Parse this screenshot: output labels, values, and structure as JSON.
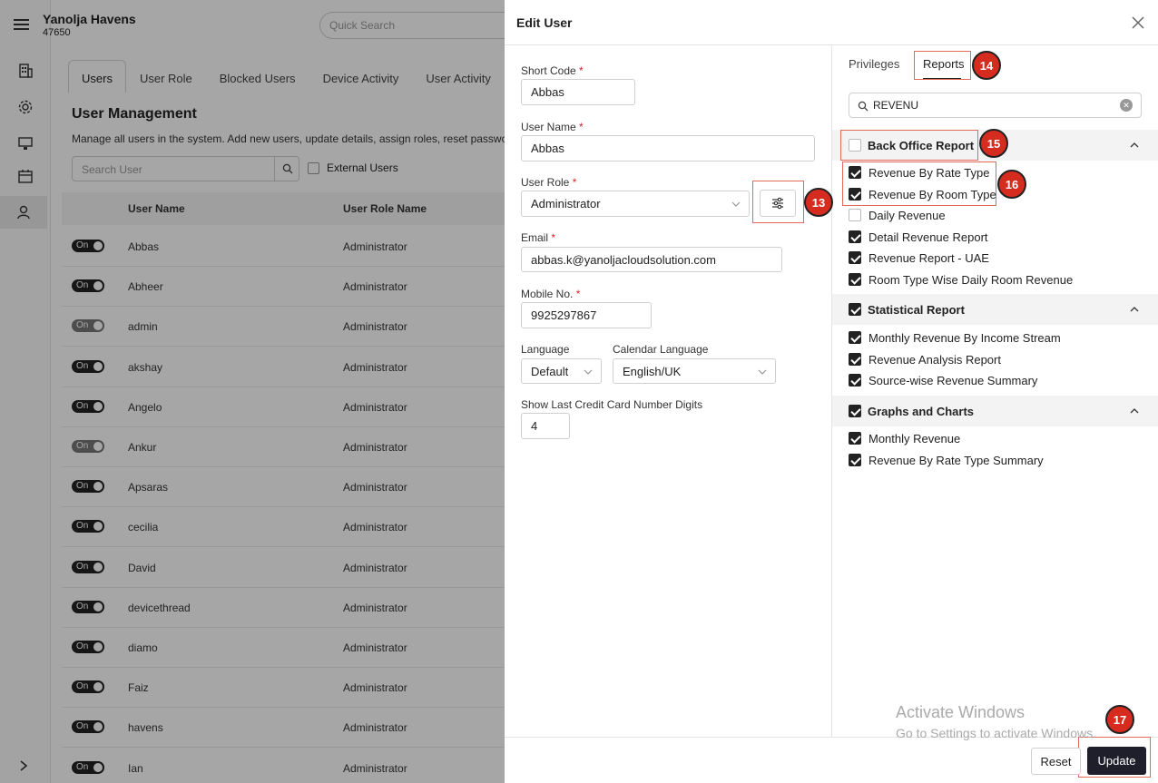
{
  "header": {
    "hotel_name": "Yanolja Havens",
    "hotel_code": "47650",
    "quick_search_placeholder": "Quick Search"
  },
  "rail": {
    "icons": [
      "menu-icon",
      "building-icon",
      "gear-icon",
      "monitor-icon",
      "calendar-icon",
      "user-icon",
      "chevron-right-icon"
    ]
  },
  "users_page": {
    "tabs": [
      "Users",
      "User Role",
      "Blocked Users",
      "Device Activity",
      "User Activity"
    ],
    "title": "User Management",
    "description": "Manage all users in the system. Add new users, update details, assign roles, reset passwords,",
    "search_placeholder": "Search User",
    "external_users_label": "External Users",
    "columns": [
      "User Name",
      "User Role Name"
    ],
    "rows": [
      {
        "toggle": "On",
        "name": "Abbas",
        "role": "Administrator",
        "active": true
      },
      {
        "toggle": "On",
        "name": "Abheer",
        "role": "Administrator",
        "active": true
      },
      {
        "toggle": "On",
        "name": "admin",
        "role": "Administrator",
        "active": false
      },
      {
        "toggle": "On",
        "name": "akshay",
        "role": "Administrator",
        "active": true
      },
      {
        "toggle": "On",
        "name": "Angelo",
        "role": "Administrator",
        "active": true
      },
      {
        "toggle": "On",
        "name": "Ankur",
        "role": "Administrator",
        "active": false
      },
      {
        "toggle": "On",
        "name": "Apsaras",
        "role": "Administrator",
        "active": true
      },
      {
        "toggle": "On",
        "name": "cecilia",
        "role": "Administrator",
        "active": true
      },
      {
        "toggle": "On",
        "name": "David",
        "role": "Administrator",
        "active": true
      },
      {
        "toggle": "On",
        "name": "devicethread",
        "role": "Administrator",
        "active": true
      },
      {
        "toggle": "On",
        "name": "diamo",
        "role": "Administrator",
        "active": true
      },
      {
        "toggle": "On",
        "name": "Faiz",
        "role": "Administrator",
        "active": true
      },
      {
        "toggle": "On",
        "name": "havens",
        "role": "Administrator",
        "active": true
      },
      {
        "toggle": "On",
        "name": "Ian",
        "role": "Administrator",
        "active": true
      }
    ]
  },
  "modal": {
    "title": "Edit User",
    "fields": {
      "short_code": {
        "label": "Short Code",
        "value": "Abbas"
      },
      "user_name": {
        "label": "User Name",
        "value": "Abbas"
      },
      "user_role": {
        "label": "User Role",
        "value": "Administrator"
      },
      "email": {
        "label": "Email",
        "value": "abbas.k@yanoljacloudsolution.com"
      },
      "mobile": {
        "label": "Mobile No.",
        "value": "9925297867"
      },
      "language": {
        "label": "Language",
        "value": "Default"
      },
      "calendar_language": {
        "label": "Calendar Language",
        "value": "English/UK"
      },
      "card_digits": {
        "label": "Show Last Credit Card Number Digits",
        "value": "4"
      }
    },
    "required_mark": "*",
    "tabs": [
      "Privileges",
      "Reports"
    ],
    "report_search": "REVENU",
    "groups": [
      {
        "label": "Back Office Report",
        "checked": false,
        "items": [
          {
            "label": "Revenue By Rate Type",
            "checked": true
          },
          {
            "label": "Revenue By Room Type",
            "checked": true
          },
          {
            "label": "Daily Revenue",
            "checked": false
          },
          {
            "label": "Detail Revenue Report",
            "checked": true
          },
          {
            "label": "Revenue Report - UAE",
            "checked": true
          },
          {
            "label": "Room Type Wise Daily Room Revenue",
            "checked": true
          }
        ]
      },
      {
        "label": "Statistical Report",
        "checked": true,
        "items": [
          {
            "label": "Monthly Revenue By Income Stream",
            "checked": true
          },
          {
            "label": "Revenue Analysis Report",
            "checked": true
          },
          {
            "label": "Source-wise Revenue Summary",
            "checked": true
          }
        ]
      },
      {
        "label": "Graphs and Charts",
        "checked": true,
        "items": [
          {
            "label": "Monthly Revenue",
            "checked": true
          },
          {
            "label": "Revenue By Rate Type Summary",
            "checked": true
          }
        ]
      }
    ],
    "buttons": {
      "reset": "Reset",
      "update": "Update"
    }
  },
  "annotations": [
    "13",
    "14",
    "15",
    "16",
    "17"
  ],
  "watermark": {
    "line1": "Activate Windows",
    "line2": "Go to Settings to activate Windows."
  },
  "colors": {
    "primary": "#1f1f2b",
    "annotation": "#d62b1f",
    "required": "#d9232d"
  }
}
